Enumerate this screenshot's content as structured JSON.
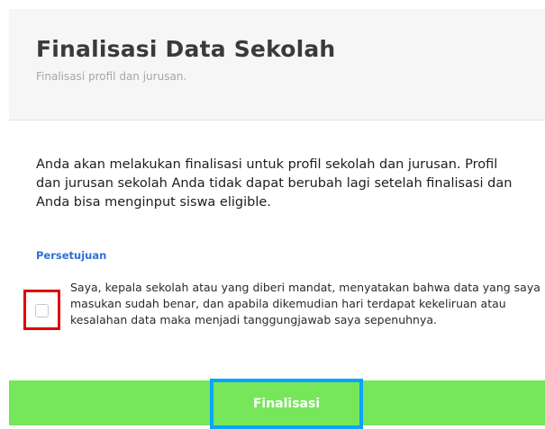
{
  "header": {
    "title": "Finalisasi Data Sekolah",
    "subtitle": "Finalisasi profil dan jurusan."
  },
  "main": {
    "message": "Anda akan melakukan finalisasi untuk profil sekolah dan jurusan. Profil dan jurusan sekolah Anda tidak dapat berubah lagi setelah finalisasi dan Anda bisa menginput siswa eligible.",
    "section_label": "Persetujuan",
    "consent_text": "Saya, kepala sekolah atau yang diberi mandat, menyatakan bahwa data yang saya masukan sudah benar, dan apabila dikemudian hari terdapat kekeliruan atau kesalahan data maka menjadi tanggungjawab saya sepenuhnya.",
    "consent_checked": false
  },
  "footer": {
    "button_label": "Finalisasi"
  },
  "colors": {
    "header_bg": "#f6f6f6",
    "section_label": "#2e6fd6",
    "footer_bg": "#76e65a",
    "checkbox_highlight": "#e00000",
    "button_highlight": "#0aa3ff"
  }
}
